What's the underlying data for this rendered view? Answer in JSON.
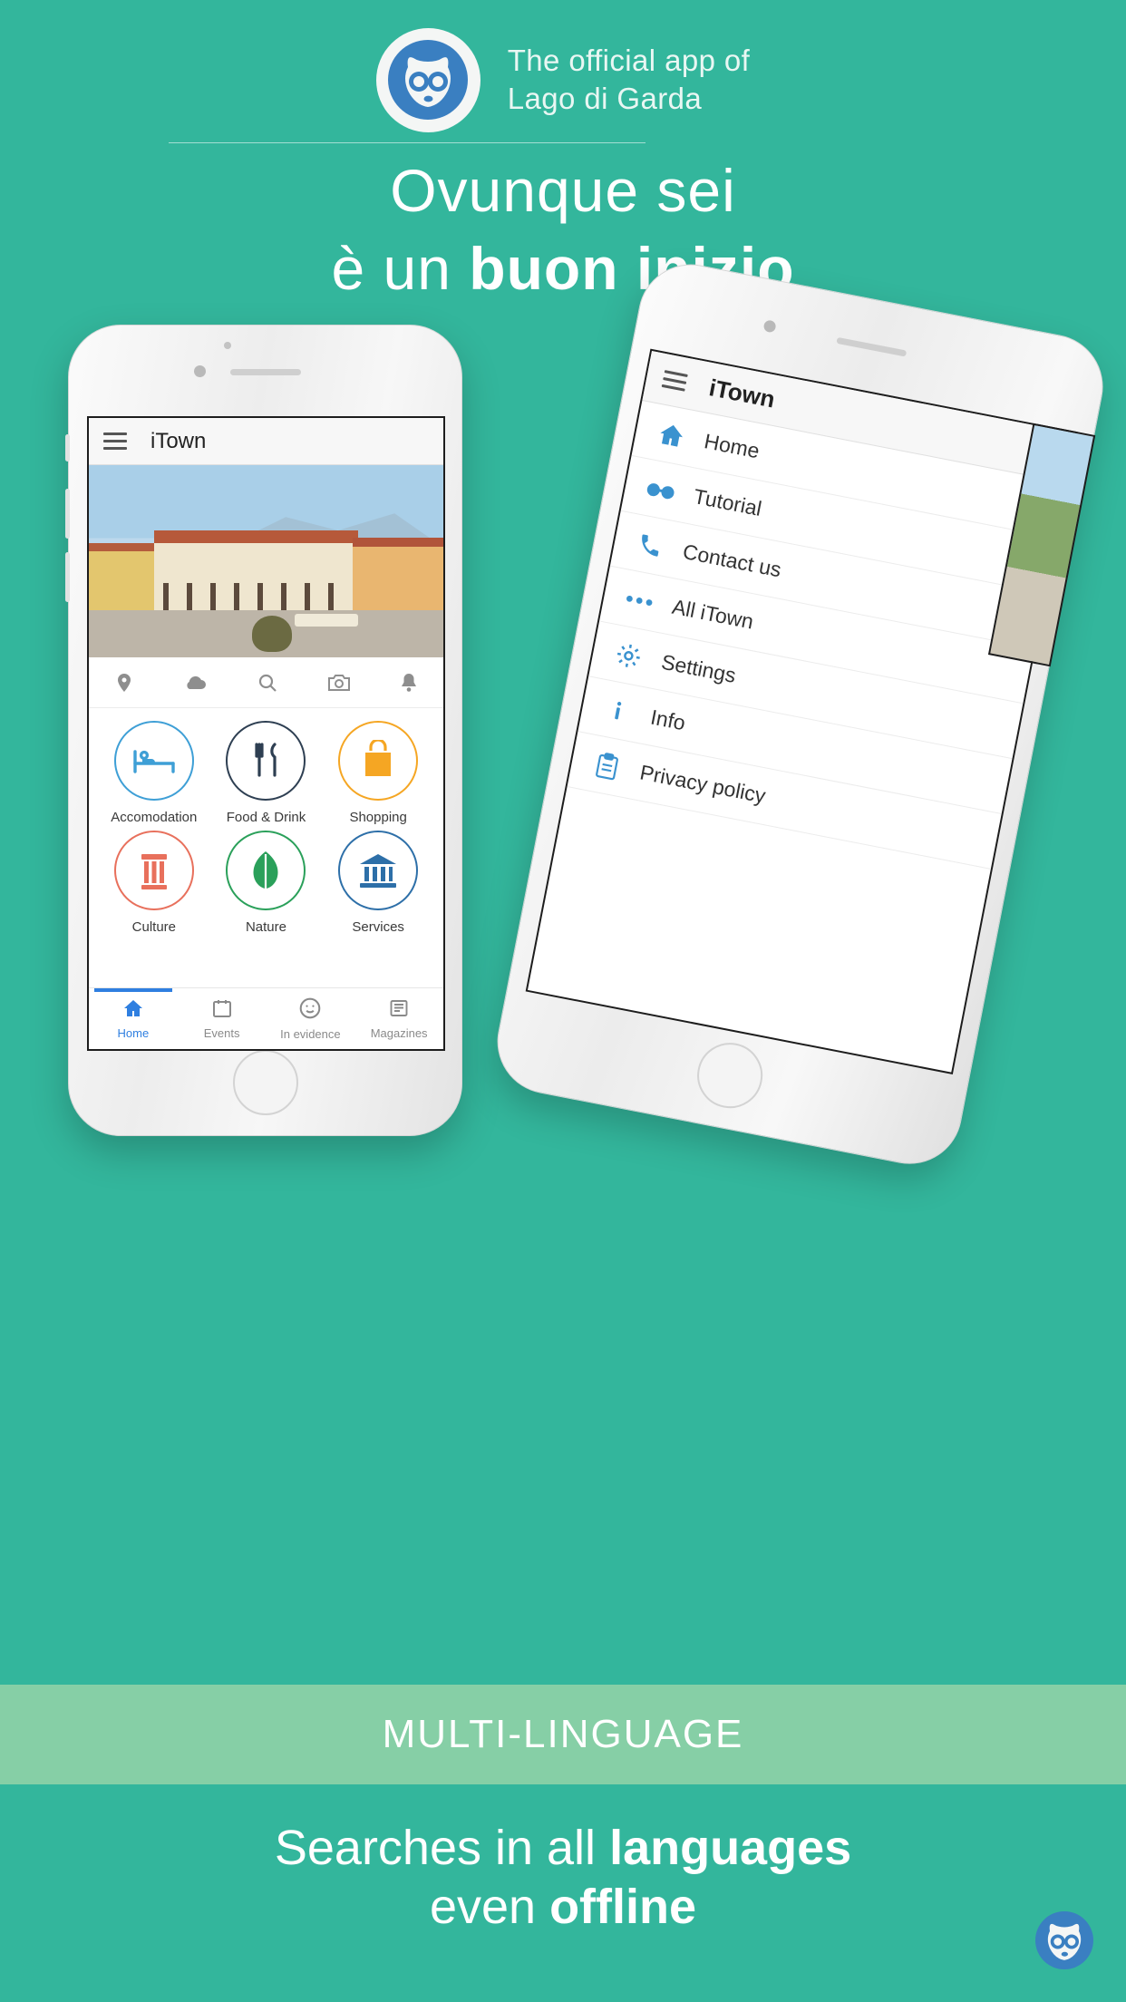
{
  "brand": {
    "accent_teal": "#33b69c",
    "band_green": "#86cfa6",
    "logo_blue": "#3a7fc1",
    "tab_blue": "#2f7fe0",
    "logo_name": "lemur-logo-icon"
  },
  "header": {
    "line1": "The official app of",
    "line2": "Lago di Garda"
  },
  "headline": {
    "line1": "Ovunque sei",
    "line2_light": "è un ",
    "line2_bold": "buon inizio"
  },
  "phone_a": {
    "appbar": {
      "menu_icon": "hamburger-icon",
      "title": "iTown"
    },
    "hero_image_alt": "town-square-photo",
    "quick_icons": [
      {
        "name": "location-pin-icon"
      },
      {
        "name": "cloud-weather-icon"
      },
      {
        "name": "search-icon"
      },
      {
        "name": "camera-icon"
      },
      {
        "name": "bell-notification-icon"
      }
    ],
    "categories": [
      {
        "label": "Accomodation",
        "icon": "bed-icon",
        "color": "#3e9fd6"
      },
      {
        "label": "Food & Drink",
        "icon": "cutlery-icon",
        "color": "#2e3f52"
      },
      {
        "label": "Shopping",
        "icon": "shopping-bag-icon",
        "color": "#f5a623"
      },
      {
        "label": "Culture",
        "icon": "column-icon",
        "color": "#e8705c"
      },
      {
        "label": "Nature",
        "icon": "leaf-icon",
        "color": "#2aa05a"
      },
      {
        "label": "Services",
        "icon": "bank-icon",
        "color": "#2d6fa8"
      }
    ],
    "tabs": [
      {
        "label": "Home",
        "icon": "home-icon",
        "active": true
      },
      {
        "label": "Events",
        "icon": "calendar-icon",
        "active": false
      },
      {
        "label": "In evidence",
        "icon": "smiley-icon",
        "active": false
      },
      {
        "label": "Magazines",
        "icon": "magazine-icon",
        "active": false
      }
    ]
  },
  "phone_b": {
    "appbar": {
      "menu_icon": "hamburger-icon",
      "title": "iTown"
    },
    "drawer": [
      {
        "label": "Home",
        "icon": "home-icon"
      },
      {
        "label": "Tutorial",
        "icon": "glasses-icon"
      },
      {
        "label": "Contact us",
        "icon": "phone-icon"
      },
      {
        "label": "All iTown",
        "icon": "ellipsis-icon"
      },
      {
        "label": "Settings",
        "icon": "gear-icon"
      },
      {
        "label": "Info",
        "icon": "info-icon"
      },
      {
        "label": "Privacy policy",
        "icon": "clipboard-icon"
      }
    ]
  },
  "band": {
    "label": "MULTI-LINGUAGE"
  },
  "footer": {
    "line1_light": "Searches in all ",
    "line1_bold": "languages",
    "line2_light": "even ",
    "line2_bold": "offline",
    "badge_icon": "lemur-logo-icon"
  }
}
